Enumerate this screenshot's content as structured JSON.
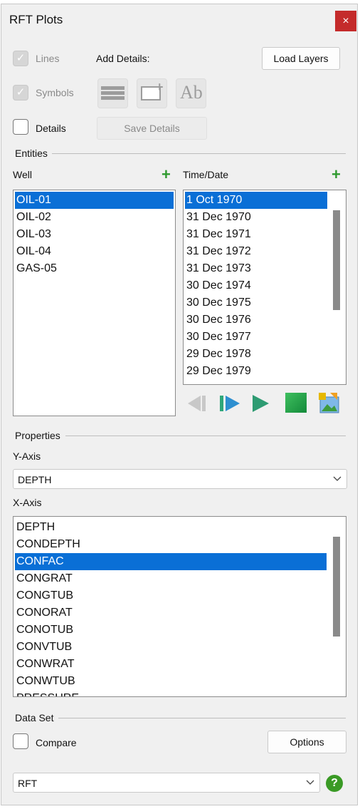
{
  "window": {
    "title": "RFT Plots",
    "close_label": "×"
  },
  "options": {
    "lines_label": "Lines",
    "symbols_label": "Symbols",
    "details_label": "Details",
    "add_details_label": "Add Details:",
    "load_layers_label": "Load Layers",
    "save_details_label": "Save Details",
    "tile_text_glyph": "Ab",
    "checkmark": "✓"
  },
  "entities": {
    "group_label": "Entities",
    "well_label": "Well",
    "time_label": "Time/Date",
    "add_icon": "+",
    "wells": [
      "OIL-01",
      "OIL-02",
      "OIL-03",
      "OIL-04",
      "GAS-05"
    ],
    "dates": [
      "1 Oct 1970",
      "31 Dec 1970",
      "31 Dec 1971",
      "31 Dec 1972",
      "31 Dec 1973",
      "30 Dec 1974",
      "30 Dec 1975",
      "30 Dec 1976",
      "30 Dec 1977",
      "29 Dec 1978",
      "29 Dec 1979"
    ]
  },
  "properties": {
    "group_label": "Properties",
    "y_axis_label": "Y-Axis",
    "y_axis_value": "DEPTH",
    "x_axis_label": "X-Axis",
    "x_axis_items": [
      "DEPTH",
      "CONDEPTH",
      "CONFAC",
      "CONGRAT",
      "CONGTUB",
      "CONORAT",
      "CONOTUB",
      "CONVTUB",
      "CONWRAT",
      "CONWTUB",
      "PRESSURE"
    ]
  },
  "dataset": {
    "group_label": "Data Set",
    "compare_label": "Compare",
    "options_label": "Options",
    "source_value": "RFT",
    "help_glyph": "?"
  },
  "colors": {
    "selection": "#0a6fd6",
    "close": "#c42b2b",
    "accent_green": "#2f9a2f"
  }
}
